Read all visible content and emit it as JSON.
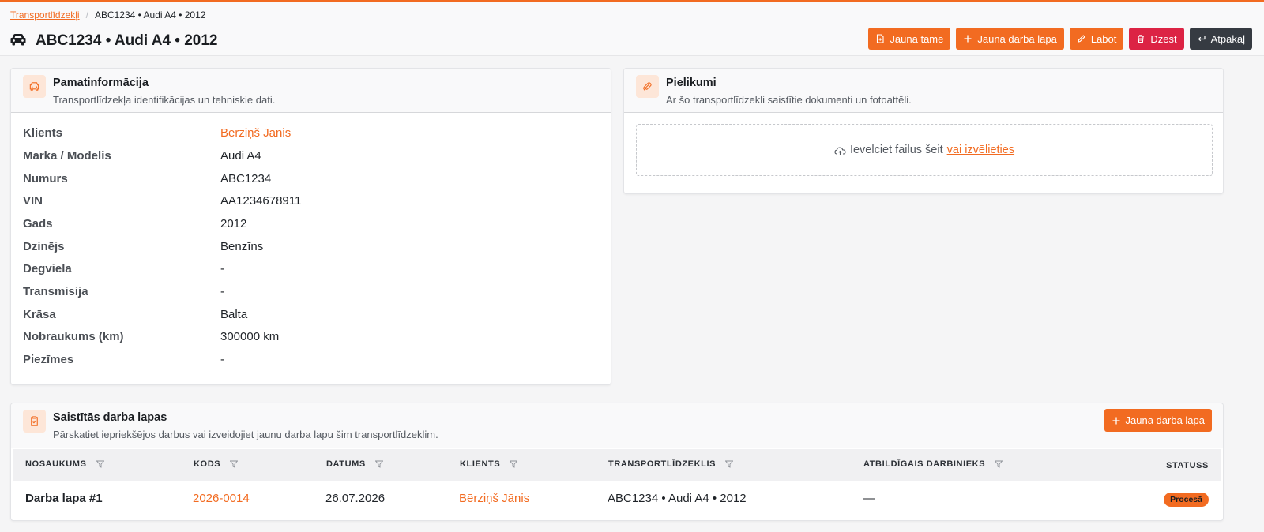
{
  "breadcrumb": {
    "parent": "Transportlīdzekļi",
    "current": "ABC1234 • Audi A4 • 2012"
  },
  "page_title": "ABC1234 • Audi A4 • 2012",
  "header_buttons": {
    "new_estimate": "Jauna tāme",
    "new_worksheet": "Jauna darba lapa",
    "edit": "Labot",
    "delete": "Dzēst",
    "back": "Atpakaļ"
  },
  "basic_info": {
    "title": "Pamatinformācija",
    "subtitle": "Transportlīdzekļa identifikācijas un tehniskie dati.",
    "rows": [
      {
        "label": "Klients",
        "value": "Bērziņš Jānis"
      },
      {
        "label": "Marka / Modelis",
        "value": "Audi A4"
      },
      {
        "label": "Numurs",
        "value": "ABC1234"
      },
      {
        "label": "VIN",
        "value": "AA1234678911"
      },
      {
        "label": "Gads",
        "value": "2012"
      },
      {
        "label": "Dzinējs",
        "value": "Benzīns"
      },
      {
        "label": "Degviela",
        "value": "-"
      },
      {
        "label": "Transmisija",
        "value": "-"
      },
      {
        "label": "Krāsa",
        "value": "Balta"
      },
      {
        "label": "Nobraukums (km)",
        "value": "300000 km"
      },
      {
        "label": "Piezīmes",
        "value": "-"
      }
    ]
  },
  "attachments": {
    "title": "Pielikumi",
    "subtitle": "Ar šo transportlīdzekli saistītie dokumenti un fotoattēli.",
    "drop_text": "Ievelciet failus šeit",
    "choose_link": "vai izvēlieties"
  },
  "worksheets": {
    "title": "Saistītās darba lapas",
    "subtitle": "Pārskatiet iepriekšējos darbus vai izveidojiet jaunu darba lapu šim transportlīdzeklim.",
    "new_button": "Jauna darba lapa",
    "columns": [
      "NOSAUKUMS",
      "KODS",
      "DATUMS",
      "KLIENTS",
      "TRANSPORTLĪDZEKLIS",
      "ATBILDĪGAIS DARBINIEKS",
      "STATUSS"
    ],
    "rows": [
      {
        "name": "Darba lapa #1",
        "code": "2026-0014",
        "date": "26.07.2026",
        "client": "Bērziņš Jānis",
        "vehicle": "ABC1234 • Audi A4 • 2012",
        "employee": "—",
        "status": "Procesā"
      }
    ]
  },
  "colors": {
    "accent": "#f26b21",
    "danger": "#dc2344",
    "dark": "#363b42"
  }
}
